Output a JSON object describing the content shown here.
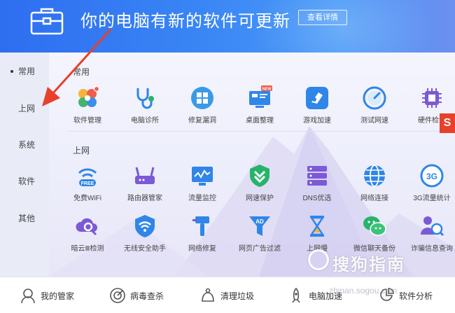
{
  "banner": {
    "title": "你的电脑有新的软件可更新",
    "details_button": "查看详情"
  },
  "sidebar": {
    "items": [
      {
        "label": "常用",
        "active": true
      },
      {
        "label": "上网",
        "active": false
      },
      {
        "label": "系统",
        "active": false
      },
      {
        "label": "软件",
        "active": false
      },
      {
        "label": "其他",
        "active": false
      }
    ]
  },
  "sections": [
    {
      "label": "常用",
      "tools": [
        {
          "label": "软件管理",
          "icon": "flower-icon"
        },
        {
          "label": "电脑诊所",
          "icon": "stethoscope-icon"
        },
        {
          "label": "修复漏洞",
          "icon": "windows-repair-icon"
        },
        {
          "label": "桌面整理",
          "icon": "desktop-icon",
          "badge": "NEW"
        },
        {
          "label": "游戏加速",
          "icon": "game-boost-icon"
        },
        {
          "label": "测试网速",
          "icon": "speedometer-icon"
        },
        {
          "label": "硬件检测",
          "icon": "chip-icon"
        }
      ]
    },
    {
      "label": "上网",
      "tools": [
        {
          "label": "免费WiFi",
          "icon": "wifi-free-icon",
          "badge": "FREE"
        },
        {
          "label": "路由器管家",
          "icon": "router-icon"
        },
        {
          "label": "流量监控",
          "icon": "traffic-monitor-icon"
        },
        {
          "label": "网速保护",
          "icon": "shield-speed-icon"
        },
        {
          "label": "DNS优选",
          "icon": "dns-server-icon"
        },
        {
          "label": "网络连接",
          "icon": "globe-icon"
        },
        {
          "label": "3G流量统计",
          "icon": "3g-icon",
          "badge": "3G"
        }
      ]
    },
    {
      "label": "",
      "tools": [
        {
          "label": "暗云Ⅲ检测",
          "icon": "cloud-scan-icon"
        },
        {
          "label": "无线安全助手",
          "icon": "wifi-shield-icon"
        },
        {
          "label": "网络修复",
          "icon": "network-repair-icon"
        },
        {
          "label": "网页广告过滤",
          "icon": "ad-filter-icon",
          "badge": "AD"
        },
        {
          "label": "上网慢",
          "icon": "hourglass-icon"
        },
        {
          "label": "微信聊天备份",
          "icon": "wechat-icon"
        },
        {
          "label": "诈骗信息查询",
          "icon": "fraud-search-icon"
        }
      ]
    }
  ],
  "bottom_bar": {
    "items": [
      {
        "label": "我的管家",
        "icon": "butler-icon"
      },
      {
        "label": "病毒查杀",
        "icon": "virus-scan-icon"
      },
      {
        "label": "清理垃圾",
        "icon": "trash-clean-icon"
      },
      {
        "label": "电脑加速",
        "icon": "rocket-icon"
      },
      {
        "label": "软件分析",
        "icon": "software-analysis-icon"
      }
    ]
  },
  "watermark": {
    "text": "搜狗指南",
    "url": "zhinan.sogou.com",
    "badge": "S"
  },
  "colors": {
    "banner_start": "#2e6ef0",
    "banner_end": "#6c8ff0",
    "annotation_arrow": "#e8402a",
    "icon_blue": "#2f86e8",
    "icon_green": "#27b36a"
  }
}
